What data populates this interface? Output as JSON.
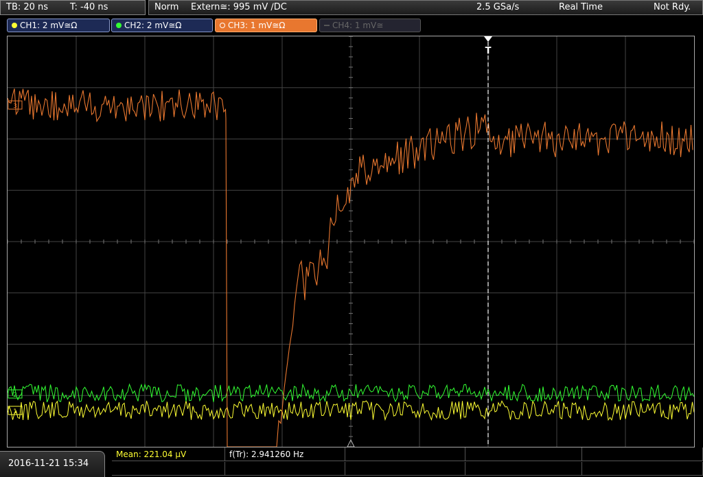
{
  "header": {
    "timebase": "TB: 20 ns",
    "trigger_time": "T: -40 ns",
    "trigger_mode": "Norm",
    "trigger_source": "Extern≅: 995 mV ∕DC",
    "sample_rate": "2.5 GSa/s",
    "acq_mode": "Real Time",
    "status": "Not Rdy."
  },
  "channels": [
    {
      "label": "CH1: 2 mV≅Ω",
      "color": "#ffff33",
      "active": true
    },
    {
      "label": "CH2: 2 mV≅Ω",
      "color": "#33ff33",
      "active": true
    },
    {
      "label": "CH3: 1 mV≅Ω",
      "color": "#e8772f",
      "active": true,
      "selected": true
    },
    {
      "label": "CH4: 1 mV≅",
      "color": "#666666",
      "active": false
    }
  ],
  "markers": {
    "trigger": "T",
    "ch3_ref": "3",
    "ch1_ref": "1",
    "ch2_ref": "2"
  },
  "footer": {
    "datetime": "2016-11-21 15:34",
    "measurements": [
      {
        "label": "Mean: 221.04 µV",
        "color": "#ffff33"
      },
      {
        "label": "f(Tr): 2.941260 Hz",
        "color": "#ffffff"
      }
    ]
  },
  "colors": {
    "ch1": "#ffff33",
    "ch2": "#33ff33",
    "ch3": "#e8772f",
    "grid": "#444444"
  }
}
